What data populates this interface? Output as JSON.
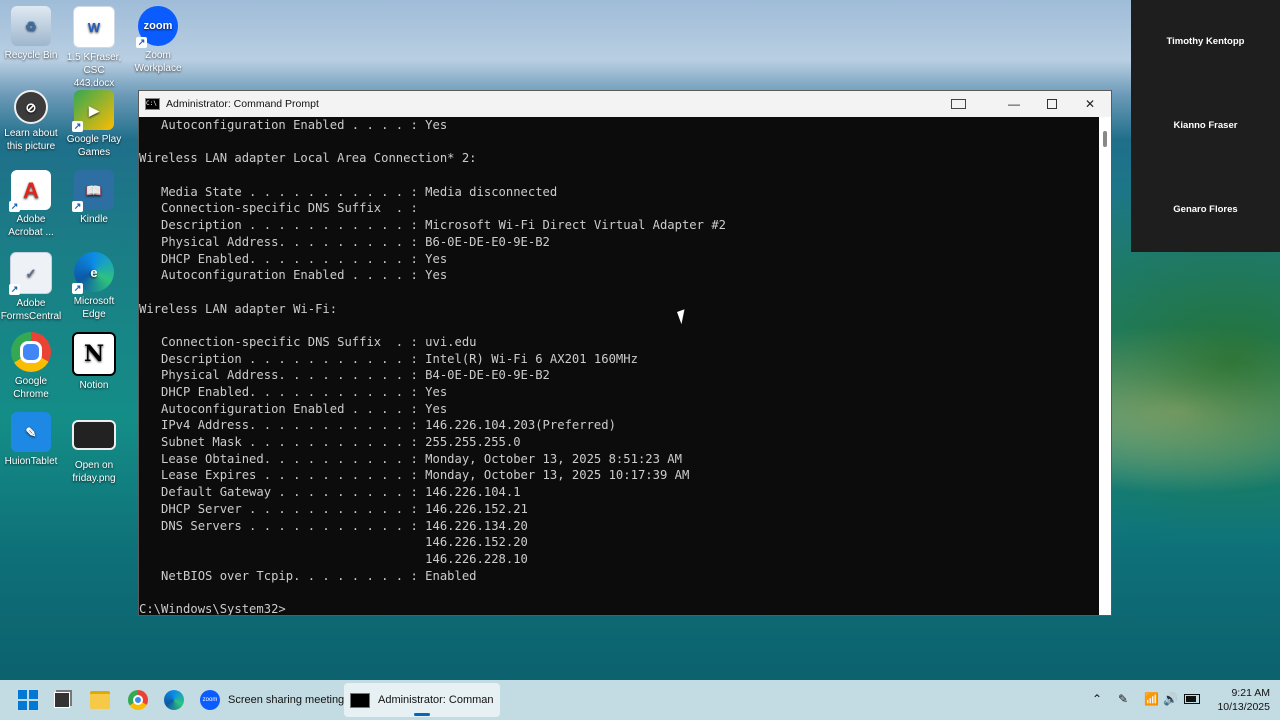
{
  "desktop": {
    "icons": [
      {
        "label": "Recycle Bin"
      },
      {
        "label": "1.5 KFraser, CSC 443.docx"
      },
      {
        "label": "Zoom Workplace"
      },
      {
        "label": "Learn about this picture"
      },
      {
        "label": "Google Play Games"
      },
      {
        "label": "Adobe Acrobat ..."
      },
      {
        "label": "Kindle"
      },
      {
        "label": "Adobe FormsCentral"
      },
      {
        "label": "Microsoft Edge"
      },
      {
        "label": "Google Chrome"
      },
      {
        "label": "Notion"
      },
      {
        "label": "HuionTablet"
      },
      {
        "label": "Open on friday.png"
      }
    ]
  },
  "participants": [
    {
      "name": "Timothy Kentopp"
    },
    {
      "name": "Kianno Fraser"
    },
    {
      "name": "Genaro Flores"
    }
  ],
  "window": {
    "title": "Administrator: Command Prompt",
    "lines": [
      "   Autoconfiguration Enabled . . . . : Yes",
      "",
      "Wireless LAN adapter Local Area Connection* 2:",
      "",
      "   Media State . . . . . . . . . . . : Media disconnected",
      "   Connection-specific DNS Suffix  . :",
      "   Description . . . . . . . . . . . : Microsoft Wi-Fi Direct Virtual Adapter #2",
      "   Physical Address. . . . . . . . . : B6-0E-DE-E0-9E-B2",
      "   DHCP Enabled. . . . . . . . . . . : Yes",
      "   Autoconfiguration Enabled . . . . : Yes",
      "",
      "Wireless LAN adapter Wi-Fi:",
      "",
      "   Connection-specific DNS Suffix  . : uvi.edu",
      "   Description . . . . . . . . . . . : Intel(R) Wi-Fi 6 AX201 160MHz",
      "   Physical Address. . . . . . . . . : B4-0E-DE-E0-9E-B2",
      "   DHCP Enabled. . . . . . . . . . . : Yes",
      "   Autoconfiguration Enabled . . . . : Yes",
      "   IPv4 Address. . . . . . . . . . . : 146.226.104.203(Preferred)",
      "   Subnet Mask . . . . . . . . . . . : 255.255.255.0",
      "   Lease Obtained. . . . . . . . . . : Monday, October 13, 2025 8:51:23 AM",
      "   Lease Expires . . . . . . . . . . : Monday, October 13, 2025 10:17:39 AM",
      "   Default Gateway . . . . . . . . . : 146.226.104.1",
      "   DHCP Server . . . . . . . . . . . : 146.226.152.21",
      "   DNS Servers . . . . . . . . . . . : 146.226.134.20",
      "                                       146.226.152.20",
      "                                       146.226.228.10",
      "   NetBIOS over Tcpip. . . . . . . . : Enabled",
      "",
      "C:\\Windows\\System32>"
    ]
  },
  "taskbar": {
    "apps": [
      {
        "label": "Screen sharing meeting"
      },
      {
        "label": "Administrator: Comman"
      }
    ],
    "time": "9:21 AM",
    "date": "10/13/2025"
  },
  "colors": {
    "console_bg": "#0c0c0c",
    "console_fg": "#cccccc",
    "titlebar_bg": "#f3f3f3",
    "taskbar_bg": "#cde3ea",
    "zoom_blue": "#0b5cff"
  },
  "icon_names": [
    "recycle-bin-icon",
    "word-icon",
    "zoom-icon",
    "learn-picture-icon",
    "google-play-games-icon",
    "acrobat-icon",
    "kindle-icon",
    "formscentral-icon",
    "edge-icon",
    "chrome-icon",
    "notion-icon",
    "huion-icon",
    "image-file-icon"
  ]
}
